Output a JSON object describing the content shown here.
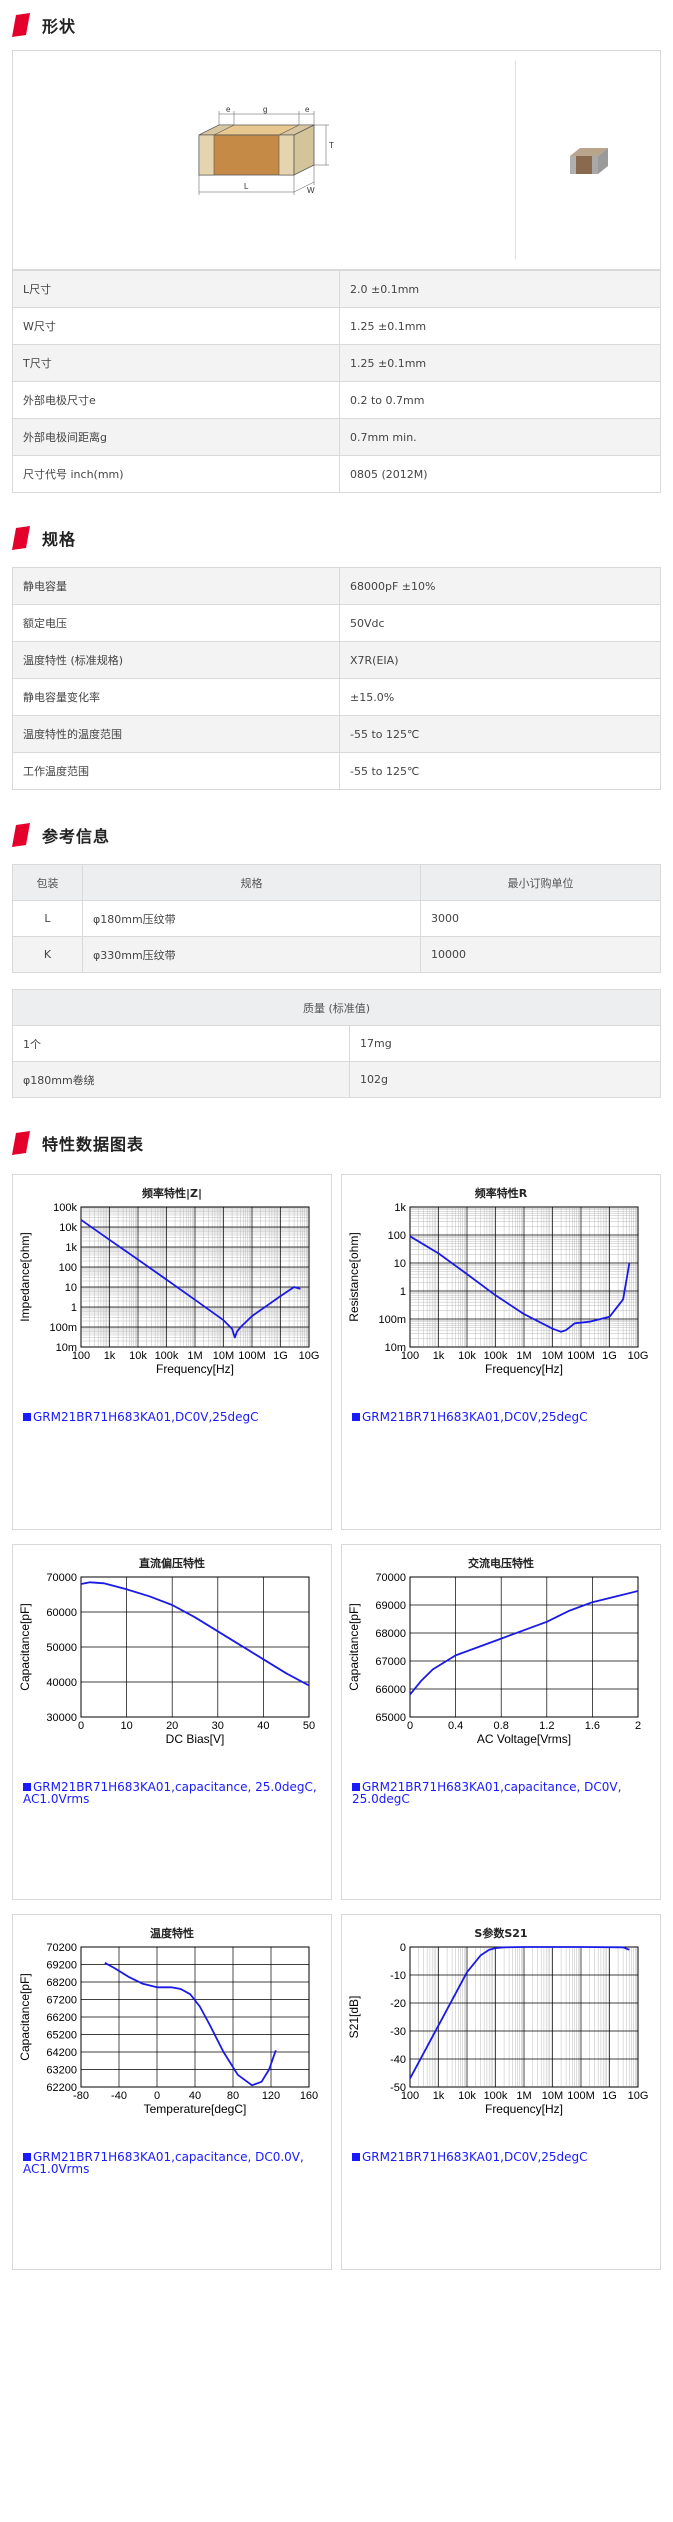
{
  "sections": {
    "shape": "形状",
    "spec": "规格",
    "ref": "参考信息",
    "charts": "特性数据图表"
  },
  "accent_color": "#e4002b",
  "shape_diagram": {
    "e1": "e",
    "g": "g",
    "e2": "e",
    "T": "T",
    "L": "L",
    "W": "W"
  },
  "dimensions": [
    {
      "k": "L尺寸",
      "v": "2.0 ±0.1mm"
    },
    {
      "k": "W尺寸",
      "v": "1.25 ±0.1mm"
    },
    {
      "k": "T尺寸",
      "v": "1.25 ±0.1mm"
    },
    {
      "k": "外部电极尺寸e",
      "v": "0.2 to 0.7mm"
    },
    {
      "k": "外部电极间距离g",
      "v": "0.7mm min."
    },
    {
      "k": "尺寸代号 inch(mm)",
      "v": "0805 (2012M)"
    }
  ],
  "specs": [
    {
      "k": "静电容量",
      "v": "68000pF ±10%"
    },
    {
      "k": "额定电压",
      "v": "50Vdc"
    },
    {
      "k": "温度特性 (标准规格)",
      "v": "X7R(EIA)"
    },
    {
      "k": "静电容量变化率",
      "v": "±15.0%"
    },
    {
      "k": "温度特性的温度范围",
      "v": "-55 to 125℃"
    },
    {
      "k": "工作温度范围",
      "v": "-55 to 125℃"
    }
  ],
  "packaging": {
    "headers": [
      "包装",
      "规格",
      "最小订购单位"
    ],
    "rows": [
      {
        "code": "L",
        "spec": "φ180mm压纹带",
        "moq": "3000"
      },
      {
        "code": "K",
        "spec": "φ330mm压纹带",
        "moq": "10000"
      }
    ]
  },
  "mass": {
    "header": "质量 (标准值)",
    "rows": [
      {
        "k": "1个",
        "v": "17mg"
      },
      {
        "k": "φ180mm卷绕",
        "v": "102g"
      }
    ]
  },
  "chart_data": [
    {
      "type": "line",
      "title": "频率特性|Z|",
      "xlabel": "Frequency[Hz]",
      "ylabel": "Impedance[ohm]",
      "xscale": "log",
      "yscale": "log",
      "xlim": [
        100,
        10000000000
      ],
      "ylim": [
        0.01,
        100000
      ],
      "xticks": [
        "100",
        "1k",
        "10k",
        "100k",
        "1M",
        "10M",
        "100M",
        "1G",
        "10G"
      ],
      "yticks": [
        "100k",
        "10k",
        "1k",
        "100",
        "10",
        "1",
        "100m",
        "10m"
      ],
      "series": [
        {
          "name": "GRM21BR71H683KA01,DC0V,25degC",
          "x": [
            100,
            1000,
            10000,
            100000,
            1000000,
            10000000,
            20000000,
            25000000,
            30000000,
            40000000,
            100000000,
            1000000000,
            3000000000,
            5000000000
          ],
          "y": [
            23000,
            2300,
            234,
            23.4,
            2.3,
            0.22,
            0.08,
            0.03,
            0.06,
            0.1,
            0.35,
            3.5,
            10,
            8
          ]
        }
      ],
      "legend": "GRM21BR71H683KA01,DC0V,25degC"
    },
    {
      "type": "line",
      "title": "频率特性R",
      "xlabel": "Frequency[Hz]",
      "ylabel": "Resistance[ohm]",
      "xscale": "log",
      "yscale": "log",
      "xlim": [
        100,
        10000000000
      ],
      "ylim": [
        0.01,
        1000
      ],
      "xticks": [
        "100",
        "1k",
        "10k",
        "100k",
        "1M",
        "10M",
        "100M",
        "1G",
        "10G"
      ],
      "yticks": [
        "1k",
        "100",
        "10",
        "1",
        "100m",
        "10m"
      ],
      "series": [
        {
          "name": "GRM21BR71H683KA01,DC0V,25degC",
          "x": [
            100,
            1000,
            10000,
            100000,
            1000000,
            10000000,
            20000000,
            30000000,
            60000000,
            200000000,
            1000000000,
            3000000000,
            5000000000
          ],
          "y": [
            90,
            22,
            4,
            0.7,
            0.15,
            0.045,
            0.035,
            0.04,
            0.07,
            0.08,
            0.12,
            0.5,
            10
          ]
        }
      ],
      "legend": "GRM21BR71H683KA01,DC0V,25degC"
    },
    {
      "type": "line",
      "title": "直流偏压特性",
      "xlabel": "DC Bias[V]",
      "ylabel": "Capacitance[pF]",
      "xlim": [
        0,
        50
      ],
      "ylim": [
        30000,
        70000
      ],
      "xticks": [
        "0",
        "10",
        "20",
        "30",
        "40",
        "50"
      ],
      "yticks": [
        "70000",
        "60000",
        "50000",
        "40000",
        "30000"
      ],
      "series": [
        {
          "name": "GRM21BR71H683KA01,capacitance, 25.0degC, AC1.0Vrms",
          "x": [
            0,
            2,
            5,
            10,
            15,
            20,
            25,
            30,
            35,
            40,
            45,
            50
          ],
          "y": [
            68000,
            68500,
            68200,
            66500,
            64500,
            62000,
            58500,
            54500,
            50500,
            46500,
            42500,
            39000
          ]
        }
      ],
      "legend": "GRM21BR71H683KA01,capacitance, 25.0degC, AC1.0Vrms"
    },
    {
      "type": "line",
      "title": "交流电压特性",
      "xlabel": "AC Voltage[Vrms]",
      "ylabel": "Capacitance[pF]",
      "xlim": [
        0,
        2
      ],
      "ylim": [
        65000,
        70000
      ],
      "xticks": [
        "0",
        "0.4",
        "0.8",
        "1.2",
        "1.6",
        "2"
      ],
      "yticks": [
        "70000",
        "69000",
        "68000",
        "67000",
        "66000",
        "65000"
      ],
      "series": [
        {
          "name": "GRM21BR71H683KA01,capacitance, DC0V, 25.0degC",
          "x": [
            0,
            0.1,
            0.2,
            0.4,
            0.6,
            0.8,
            1.0,
            1.2,
            1.4,
            1.6,
            1.8,
            2.0
          ],
          "y": [
            65800,
            66300,
            66700,
            67200,
            67500,
            67800,
            68100,
            68400,
            68800,
            69100,
            69300,
            69500
          ]
        }
      ],
      "legend": "GRM21BR71H683KA01,capacitance, DC0V, 25.0degC"
    },
    {
      "type": "line",
      "title": "温度特性",
      "xlabel": "Temperature[degC]",
      "ylabel": "Capacitance[pF]",
      "xlim": [
        -80,
        160
      ],
      "ylim": [
        62200,
        70200
      ],
      "xticks": [
        "-80",
        "-40",
        "0",
        "40",
        "80",
        "120",
        "160"
      ],
      "yticks": [
        "70200",
        "69200",
        "68200",
        "67200",
        "66200",
        "65200",
        "64200",
        "63200",
        "62200"
      ],
      "series": [
        {
          "name": "GRM21BR71H683KA01,capacitance, DC0.0V, AC1.0Vrms",
          "x": [
            -55,
            -45,
            -30,
            -15,
            0,
            15,
            25,
            35,
            45,
            55,
            70,
            85,
            100,
            110,
            118,
            125
          ],
          "y": [
            69300,
            69000,
            68500,
            68100,
            67900,
            67900,
            67800,
            67500,
            66800,
            65800,
            64200,
            62900,
            62300,
            62500,
            63200,
            64300
          ]
        }
      ],
      "legend": "GRM21BR71H683KA01,capacitance, DC0.0V, AC1.0Vrms"
    },
    {
      "type": "line",
      "title": "S参数S21",
      "xlabel": "Frequency[Hz]",
      "ylabel": "S21[dB]",
      "xscale": "log",
      "xlim": [
        100,
        10000000000
      ],
      "ylim": [
        -50,
        0
      ],
      "xticks": [
        "100",
        "1k",
        "10k",
        "100k",
        "1M",
        "10M",
        "100M",
        "1G",
        "10G"
      ],
      "yticks": [
        "0",
        "-10",
        "-20",
        "-30",
        "-40",
        "-50"
      ],
      "series": [
        {
          "name": "GRM21BR71H683KA01,DC0V,25degC",
          "x": [
            100,
            1000,
            10000,
            30000,
            60000,
            100000,
            200000,
            1000000,
            100000000,
            3000000000,
            5000000000
          ],
          "y": [
            -47,
            -28,
            -9,
            -3,
            -1,
            -0.4,
            -0.1,
            0,
            0,
            -0.1,
            -1
          ]
        }
      ],
      "legend": "GRM21BR71H683KA01,DC0V,25degC"
    }
  ]
}
